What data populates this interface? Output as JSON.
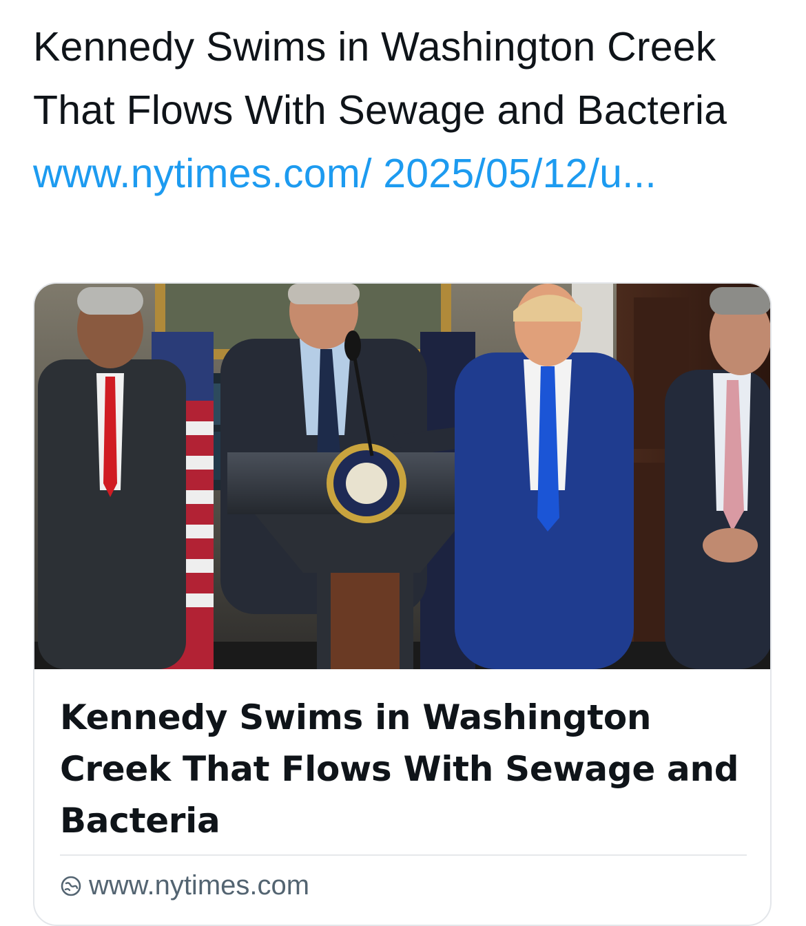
{
  "post": {
    "text": "Kennedy Swims in Washington Creek That Flows With Sewage and Bacteria",
    "link_line1": "www.nytimes.com/",
    "link_line2": "2025/05/12/u..."
  },
  "card": {
    "image_icon": "news-photo",
    "title": "Kennedy Swims in Washington Creek That Flows With Sewage and Bacteria",
    "domain": "www.nytimes.com",
    "domain_icon": "link-globe-icon"
  },
  "colors": {
    "link": "#1d9bf0",
    "text": "#0f1419",
    "muted": "#536471",
    "border": "#e3e6ea"
  }
}
